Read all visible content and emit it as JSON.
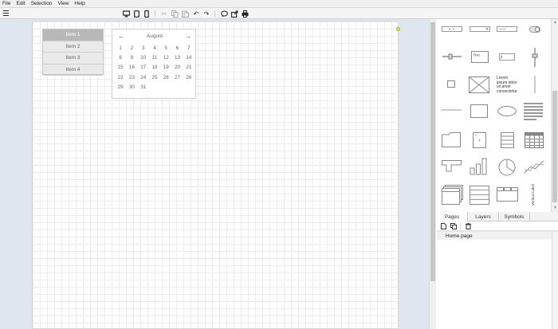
{
  "menubar": {
    "items": [
      "File",
      "Edit",
      "Selection",
      "View",
      "Help"
    ]
  },
  "toolbar": {
    "icons": [
      "menu-icon",
      "desktop-icon",
      "tablet-icon",
      "phone-icon",
      "cut-icon",
      "copy-icon",
      "paste-icon",
      "undo-icon",
      "redo-icon",
      "comment-icon",
      "export-icon",
      "print-icon"
    ]
  },
  "canvas": {
    "menu_widget": {
      "items": [
        "Item 1",
        "Item 2",
        "Item 3",
        "Item 4"
      ],
      "active_index": 0
    },
    "calendar": {
      "month": "August",
      "prev": "←",
      "next": "→",
      "weeks": [
        [
          "1",
          "2",
          "3",
          "4",
          "5",
          "6",
          "7"
        ],
        [
          "8",
          "9",
          "10",
          "11",
          "12",
          "13",
          "14"
        ],
        [
          "15",
          "16",
          "17",
          "18",
          "19",
          "20",
          "21"
        ],
        [
          "22",
          "23",
          "24",
          "25",
          "26",
          "27",
          "28"
        ],
        [
          "29",
          "30",
          "31",
          "",
          "",
          "",
          ""
        ]
      ]
    }
  },
  "library": {
    "text_field_label": "Text",
    "paragraph_text": "Lorem ipsum dolor sit amet consectetur",
    "vertical_label": "Vertical Label"
  },
  "panel": {
    "tabs": [
      "Pages",
      "Layers",
      "Symbols"
    ],
    "active_tab": "Pages",
    "pages": [
      "Home page"
    ]
  }
}
